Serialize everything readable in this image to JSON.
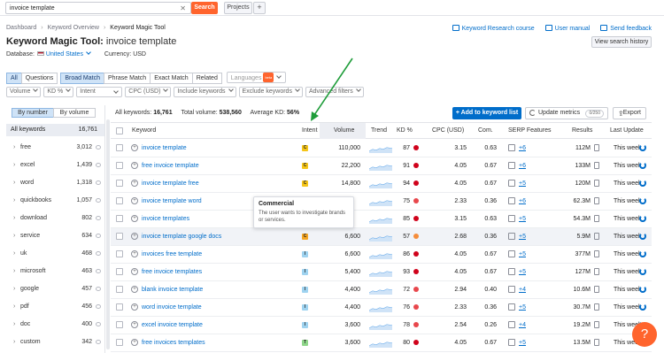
{
  "search": {
    "value": "invoice template",
    "button": "Search",
    "projects": "Projects",
    "plus": "+"
  },
  "breadcrumb": [
    "Dashboard",
    "Keyword Overview",
    "Keyword Magic Tool"
  ],
  "top_links": {
    "research_course": "Keyword Research course",
    "user_manual": "User manual",
    "feedback": "Send feedback"
  },
  "title": {
    "tool": "Keyword Magic Tool:",
    "query": "invoice template"
  },
  "view_history": "View search history",
  "database": {
    "label": "Database:",
    "value": "United States",
    "currency": "Currency: USD"
  },
  "tabs": {
    "all": "All",
    "questions": "Questions",
    "broad": "Broad Match",
    "phrase": "Phrase Match",
    "exact": "Exact Match",
    "related": "Related",
    "languages": "Languages",
    "beta": "beta"
  },
  "filters": [
    "Volume",
    "KD %",
    "Intent",
    "CPC (USD)",
    "Include keywords",
    "Exclude keywords",
    "Advanced filters"
  ],
  "sidebar": {
    "by_number": "By number",
    "by_volume": "By volume",
    "all_label": "All keywords",
    "all_count": "16,761",
    "groups": [
      {
        "name": "free",
        "count": "3,012"
      },
      {
        "name": "excel",
        "count": "1,439"
      },
      {
        "name": "word",
        "count": "1,318"
      },
      {
        "name": "quickbooks",
        "count": "1,057"
      },
      {
        "name": "download",
        "count": "802"
      },
      {
        "name": "service",
        "count": "634"
      },
      {
        "name": "uk",
        "count": "468"
      },
      {
        "name": "microsoft",
        "count": "463"
      },
      {
        "name": "google",
        "count": "457"
      },
      {
        "name": "pdf",
        "count": "456"
      },
      {
        "name": "doc",
        "count": "400"
      },
      {
        "name": "custom",
        "count": "342"
      }
    ]
  },
  "summary": {
    "all_kw_label": "All keywords:",
    "all_kw": "16,761",
    "volume_label": "Total volume:",
    "volume": "538,560",
    "kd_label": "Average KD:",
    "kd": "56%"
  },
  "actions": {
    "add": "+ Add to keyword list",
    "update": "Update metrics",
    "update_count": "0/250",
    "export": "Export"
  },
  "columns": {
    "keyword": "Keyword",
    "intent": "Intent",
    "volume": "Volume",
    "trend": "Trend",
    "kd": "KD %",
    "cpc": "CPC (USD)",
    "com": "Com.",
    "serp": "SERP Features",
    "results": "Results",
    "last_update": "Last Update"
  },
  "rows": [
    {
      "kw": "invoice template",
      "intent": "C",
      "intent_color": "#f5c518",
      "volume": "110,000",
      "kd": "87",
      "kd_color": "#d0021b",
      "cpc": "3.15",
      "com": "0.63",
      "serp": "+6",
      "results": "112M",
      "upd": "This week"
    },
    {
      "kw": "free invoice template",
      "intent": "C",
      "intent_color": "#f5c518",
      "volume": "22,200",
      "kd": "91",
      "kd_color": "#d0021b",
      "cpc": "4.05",
      "com": "0.67",
      "serp": "+6",
      "results": "133M",
      "upd": "This week"
    },
    {
      "kw": "invoice template free",
      "intent": "C",
      "intent_color": "#f5c518",
      "volume": "14,800",
      "kd": "94",
      "kd_color": "#d0021b",
      "cpc": "4.05",
      "com": "0.67",
      "serp": "+5",
      "results": "120M",
      "upd": "This week"
    },
    {
      "kw": "invoice template word",
      "intent": "",
      "intent_color": "#f5c518",
      "volume": "",
      "kd": "75",
      "kd_color": "#e8474c",
      "cpc": "2.33",
      "com": "0.36",
      "serp": "+6",
      "results": "62.3M",
      "upd": "This week"
    },
    {
      "kw": "invoice templates",
      "intent": "",
      "intent_color": "#f5c518",
      "volume": "",
      "kd": "85",
      "kd_color": "#d0021b",
      "cpc": "3.15",
      "com": "0.63",
      "serp": "+5",
      "results": "54.3M",
      "upd": "This week"
    },
    {
      "kw": "invoice template google docs",
      "intent": "C",
      "intent_color": "#f5a623",
      "volume": "6,600",
      "kd": "57",
      "kd_color": "#f58c3a",
      "cpc": "2.68",
      "com": "0.36",
      "serp": "+5",
      "results": "5.9M",
      "upd": "This week"
    },
    {
      "kw": "invoices free template",
      "intent": "I",
      "intent_color": "#9fd3f0",
      "volume": "6,600",
      "kd": "86",
      "kd_color": "#d0021b",
      "cpc": "4.05",
      "com": "0.67",
      "serp": "+5",
      "results": "377M",
      "upd": "This week"
    },
    {
      "kw": "free invoice templates",
      "intent": "I",
      "intent_color": "#9fd3f0",
      "volume": "5,400",
      "kd": "93",
      "kd_color": "#d0021b",
      "cpc": "4.05",
      "com": "0.67",
      "serp": "+5",
      "results": "127M",
      "upd": "This week"
    },
    {
      "kw": "blank invoice template",
      "intent": "I",
      "intent_color": "#9fd3f0",
      "volume": "4,400",
      "kd": "72",
      "kd_color": "#e8474c",
      "cpc": "2.94",
      "com": "0.40",
      "serp": "+4",
      "results": "10.6M",
      "upd": "This week"
    },
    {
      "kw": "word invoice template",
      "intent": "I",
      "intent_color": "#9fd3f0",
      "volume": "4,400",
      "kd": "76",
      "kd_color": "#e8474c",
      "cpc": "2.33",
      "com": "0.36",
      "serp": "+5",
      "results": "30.7M",
      "upd": "This week"
    },
    {
      "kw": "excel invoice template",
      "intent": "I",
      "intent_color": "#9fd3f0",
      "volume": "3,600",
      "kd": "78",
      "kd_color": "#e8474c",
      "cpc": "2.54",
      "com": "0.26",
      "serp": "+4",
      "results": "19.2M",
      "upd": "This week"
    },
    {
      "kw": "free invoices templates",
      "intent": "T",
      "intent_color": "#8fd68a",
      "volume": "3,600",
      "kd": "80",
      "kd_color": "#d0021b",
      "cpc": "4.05",
      "com": "0.67",
      "serp": "+5",
      "results": "13.5M",
      "upd": "This week"
    }
  ],
  "tooltip": {
    "title": "Commercial",
    "desc": "The user wants to investigate brands or services."
  },
  "help": "?",
  "colors": {
    "accent": "#006dca",
    "brand": "#ff642d",
    "arrow": "#1f9d3a"
  }
}
